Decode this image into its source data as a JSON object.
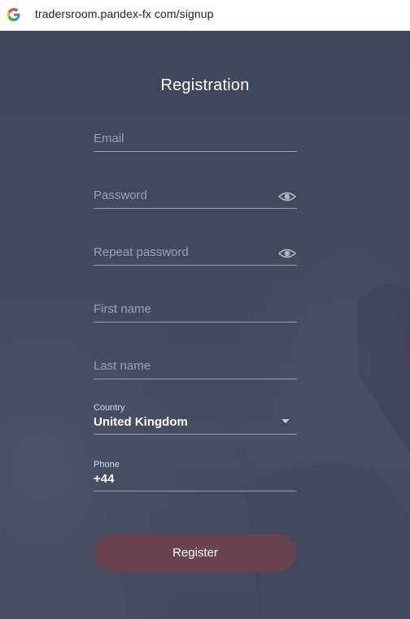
{
  "browser": {
    "url": "tradersroom.pandex-fx com/signup",
    "favicon_icon": "google-g-icon"
  },
  "form": {
    "title": "Registration",
    "email": {
      "placeholder": "Email"
    },
    "password": {
      "placeholder": "Password",
      "icon": "eye-icon"
    },
    "repeat_password": {
      "placeholder": "Repeat password",
      "icon": "eye-icon"
    },
    "first_name": {
      "placeholder": "First name"
    },
    "last_name": {
      "placeholder": "Last name"
    },
    "country": {
      "label": "Country",
      "value": "United Kingdom",
      "icon": "caret-down-icon"
    },
    "phone": {
      "label": "Phone",
      "value": "+44"
    },
    "register_label": "Register"
  },
  "colors": {
    "background": "#424a5c",
    "text": "#ffffff",
    "placeholder": "#9ca2b0",
    "button": "#6a4250"
  }
}
